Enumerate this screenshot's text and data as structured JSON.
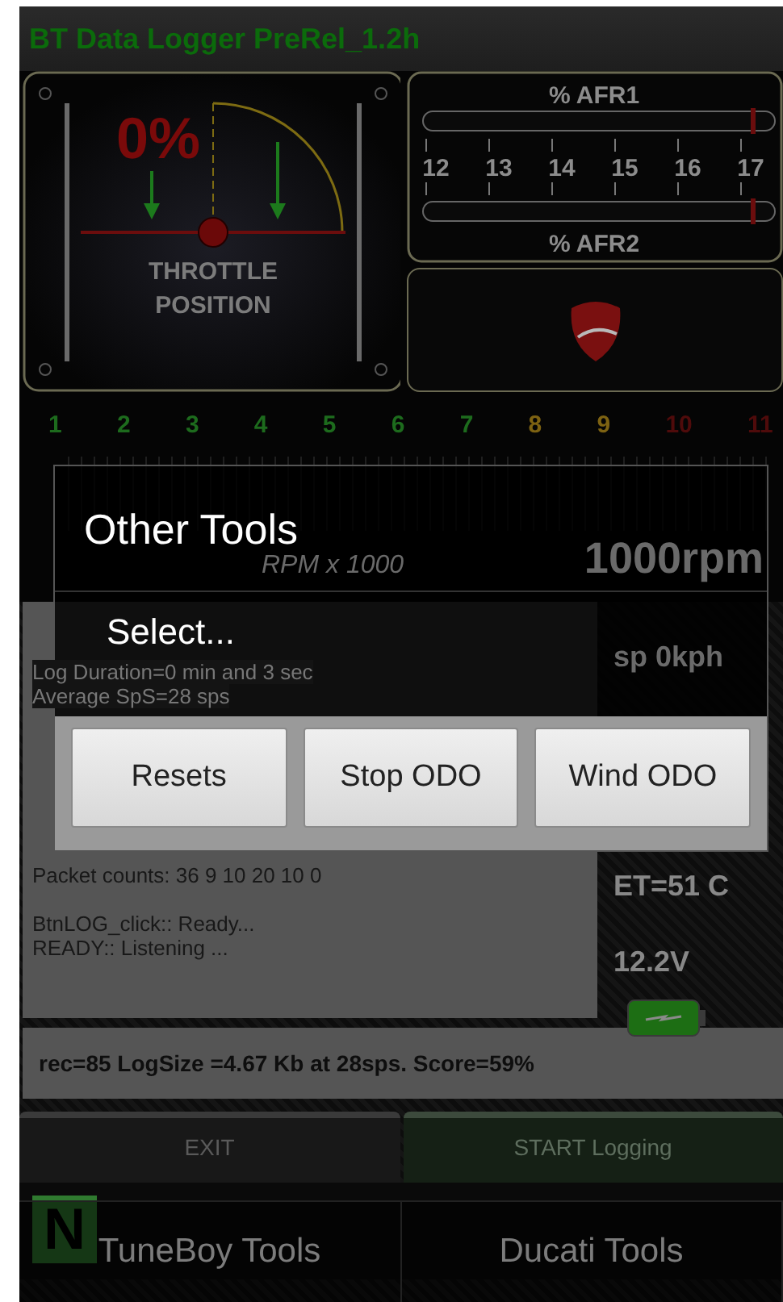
{
  "app_title": "BT Data Logger PreRel_1.2h",
  "throttle": {
    "reading": "0%",
    "label_lines": [
      "THROTTLE",
      "POSITION"
    ]
  },
  "afr": {
    "top_label": "% AFR1",
    "bottom_label": "% AFR2",
    "scale": [
      "12",
      "13",
      "14",
      "15",
      "16",
      "17"
    ]
  },
  "rpm": {
    "ticks": [
      {
        "label": "1",
        "color": "#1d6b1d"
      },
      {
        "label": "2",
        "color": "#1d6b1d"
      },
      {
        "label": "3",
        "color": "#1d6b1d"
      },
      {
        "label": "4",
        "color": "#1d6b1d"
      },
      {
        "label": "5",
        "color": "#1d6b1d"
      },
      {
        "label": "6",
        "color": "#1d6b1d"
      },
      {
        "label": "7",
        "color": "#1d6b1d"
      },
      {
        "label": "8",
        "color": "#7d6212"
      },
      {
        "label": "9",
        "color": "#7d6212"
      },
      {
        "label": "10",
        "color": "#4f0b0b"
      },
      {
        "label": "11",
        "color": "#4f0b0b"
      }
    ],
    "unit_label": "RPM x 1000",
    "reading": "1000rpm"
  },
  "log": {
    "lines": [
      "Log Duration=0 min and 3 sec",
      "Average SpS=28 sps"
    ],
    "lower_lines": [
      "Packet counts: 36 9 10 20 10 0",
      "BtnLOG_click:: Ready...",
      "READY:: Listening ..."
    ]
  },
  "readouts": [
    "sp 0kph",
    "ET=51 C",
    "12.2V"
  ],
  "status": "rec=85 LogSize =4.67 Kb at 28sps. Score=59%",
  "buttons": [
    {
      "label": "EXIT",
      "kind": "exit"
    },
    {
      "label": "START Logging",
      "kind": "start"
    }
  ],
  "gear": "N",
  "menu": [
    "TuneBoy Tools",
    "Ducati Tools"
  ],
  "dialog": {
    "title": "Other Tools",
    "message": "Select...",
    "buttons": [
      "Resets",
      "Stop ODO",
      "Wind ODO"
    ]
  }
}
